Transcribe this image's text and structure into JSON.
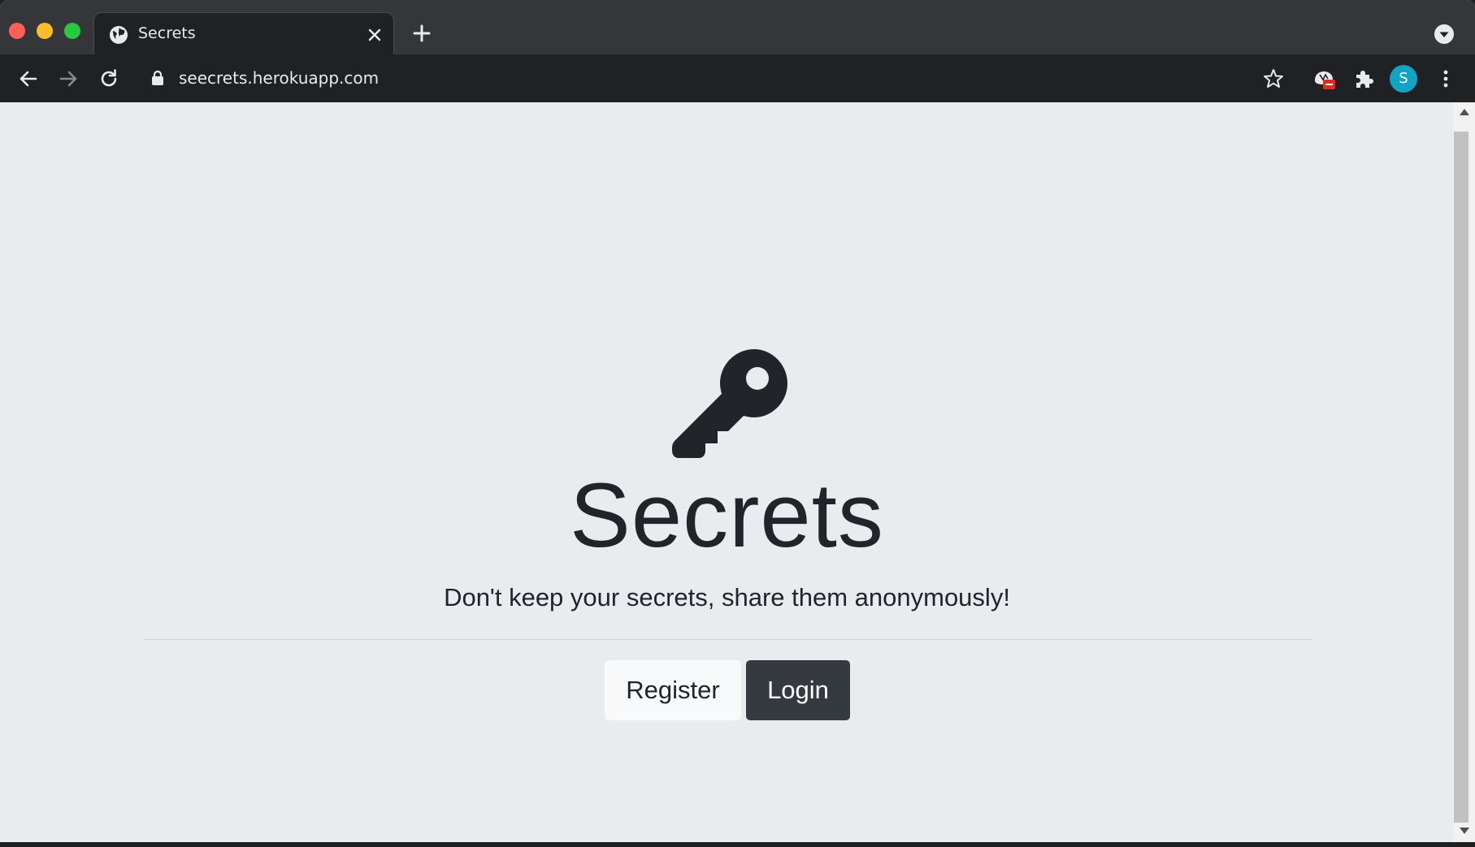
{
  "browser": {
    "tab": {
      "title": "Secrets",
      "favicon": "globe-icon"
    },
    "address_bar": {
      "url": "seecrets.herokuapp.com",
      "secure_icon": "lock-icon"
    },
    "profile_initial": "S",
    "colors": {
      "avatar": "#12a4c4",
      "extension_badge": "#d93025"
    }
  },
  "hero": {
    "icon": "key-icon",
    "title": "Secrets",
    "tagline": "Don't keep your secrets, share them anonymously!"
  },
  "actions": {
    "register_label": "Register",
    "login_label": "Login"
  },
  "colors": {
    "page_background": "#e9ecef",
    "text": "#212529",
    "login_button": "#343a40",
    "register_button": "#f8f9fa"
  }
}
